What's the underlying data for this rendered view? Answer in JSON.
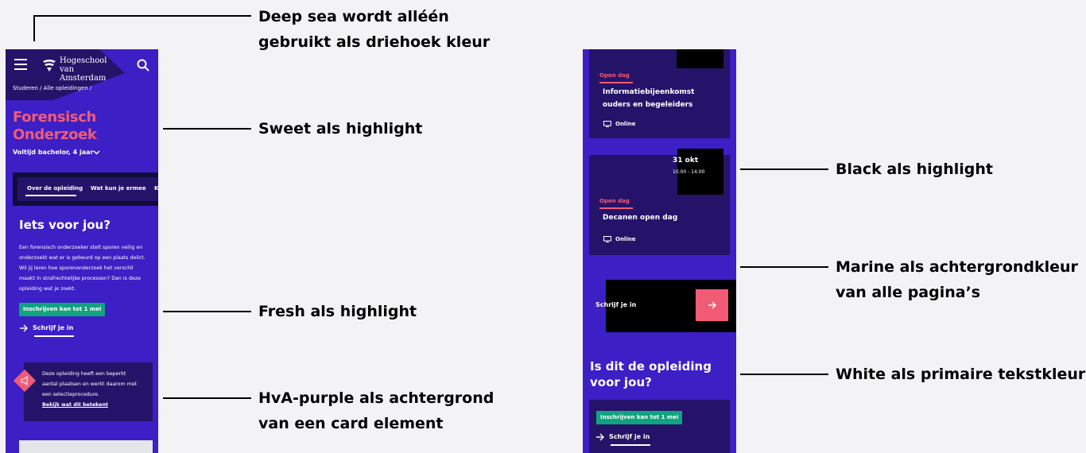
{
  "annotations": {
    "deep_sea_1": "Deep sea wordt alléén",
    "deep_sea_2": "gebruikt als driehoek kleur",
    "sweet": "Sweet als highlight",
    "fresh": "Fresh als highlight",
    "purple_1": "HvA-purple als achtergrond",
    "purple_2": "van een card element",
    "black": "Black als highlight",
    "marine_1": "Marine als achtergrondkleur",
    "marine_2": "van alle pagina’s",
    "white": "White als primaire tekstkleur"
  },
  "phone1": {
    "logo_line1": "Hogeschool",
    "logo_line2": "van Amsterdam",
    "breadcrumb": "Studeren  /  Alle opleidingen  /",
    "title_line1": "Forensisch",
    "title_line2": "Onderzoek",
    "subtitle": "Voltijd bachelor, 4 jaar",
    "tabs": [
      "Over de opleiding",
      "Wat kun je ermee",
      "Ko"
    ],
    "section_heading": "Iets voor jou?",
    "intro": [
      "Een forensisch onderzoeker stelt sporen veilig en",
      "onderzoekt wat er is gebeurd op een plaats delict.",
      "Wil jij leren hoe sporenonderzoek het verschil",
      "maakt in strafrechtelijke processen? Dan is deze",
      "opleiding wat je zoekt."
    ],
    "enroll_badge": "Inschrijven kan tot 1 mei",
    "cta": "Schrijf je in",
    "notice": [
      "Deze opleiding heeft een beperkt",
      "aantal plaatsen en werkt daarom met",
      "een selectieprocedure."
    ],
    "notice_link": "Bekijk wat dit betekent"
  },
  "phone2": {
    "card1": {
      "label": "Open dag",
      "title_line1": "Informatiebijeenkomst",
      "title_line2": "ouders en begeleiders",
      "location": "Online"
    },
    "card2": {
      "date": "31 okt",
      "time": "10.00 - 14.00",
      "label": "Open dag",
      "title": "Decanen open dag",
      "location": "Online"
    },
    "cta_block": "Schrijf je in",
    "heading_line1": "Is dit de opleiding",
    "heading_line2": "voor jou?",
    "enroll_badge": "Inschrijven kan tot 1 mei",
    "cta": "Schrijf je in"
  },
  "colors": {
    "marine": "#3c1fc5",
    "hva_purple": "#25136a",
    "deep_sea": "#25136a",
    "sweet": "#f25b75",
    "fresh": "#10a37f",
    "black": "#000000",
    "white": "#ffffff"
  }
}
